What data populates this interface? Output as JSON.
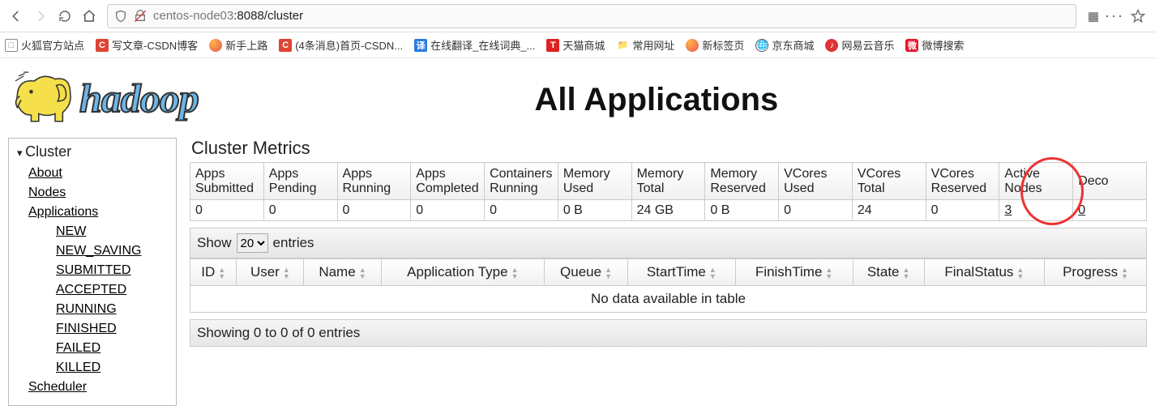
{
  "browser": {
    "url_host": "centos-node03",
    "url_path": ":8088/cluster"
  },
  "bookmarks": [
    {
      "label": "火狐官方站点",
      "icon": "ff-outline"
    },
    {
      "label": "写文章-CSDN博客",
      "icon": "csdn"
    },
    {
      "label": "新手上路",
      "icon": "ff"
    },
    {
      "label": "(4条消息)首页-CSDN...",
      "icon": "csdn"
    },
    {
      "label": "在线翻译_在线词典_...",
      "icon": "blue"
    },
    {
      "label": "天猫商城",
      "icon": "tm"
    },
    {
      "label": "常用网址",
      "icon": "folder"
    },
    {
      "label": "新标签页",
      "icon": "ff"
    },
    {
      "label": "京东商城",
      "icon": "globe"
    },
    {
      "label": "网易云音乐",
      "icon": "netease"
    },
    {
      "label": "微博搜索",
      "icon": "weibo"
    }
  ],
  "page": {
    "title": "All Applications"
  },
  "sidebar": {
    "title": "Cluster",
    "links": [
      {
        "label": "About"
      },
      {
        "label": "Nodes"
      },
      {
        "label": "Applications",
        "sub": [
          {
            "label": "NEW"
          },
          {
            "label": "NEW_SAVING"
          },
          {
            "label": "SUBMITTED"
          },
          {
            "label": "ACCEPTED"
          },
          {
            "label": "RUNNING"
          },
          {
            "label": "FINISHED"
          },
          {
            "label": "FAILED"
          },
          {
            "label": "KILLED"
          }
        ]
      },
      {
        "label": "Scheduler"
      }
    ]
  },
  "metrics": {
    "title": "Cluster Metrics",
    "headers": [
      "Apps Submitted",
      "Apps Pending",
      "Apps Running",
      "Apps Completed",
      "Containers Running",
      "Memory Used",
      "Memory Total",
      "Memory Reserved",
      "VCores Used",
      "VCores Total",
      "VCores Reserved",
      "Active Nodes",
      "Deco"
    ],
    "values": [
      "0",
      "0",
      "0",
      "0",
      "0",
      "0 B",
      "24 GB",
      "0 B",
      "0",
      "24",
      "0",
      "3",
      "0"
    ],
    "link_cols": [
      11,
      12
    ]
  },
  "apps": {
    "show_prefix": "Show",
    "show_value": "20",
    "show_suffix": "entries",
    "headers": [
      "ID",
      "User",
      "Name",
      "Application Type",
      "Queue",
      "StartTime",
      "FinishTime",
      "State",
      "FinalStatus",
      "Progress"
    ],
    "empty": "No data available in table",
    "footer": "Showing 0 to 0 of 0 entries"
  }
}
